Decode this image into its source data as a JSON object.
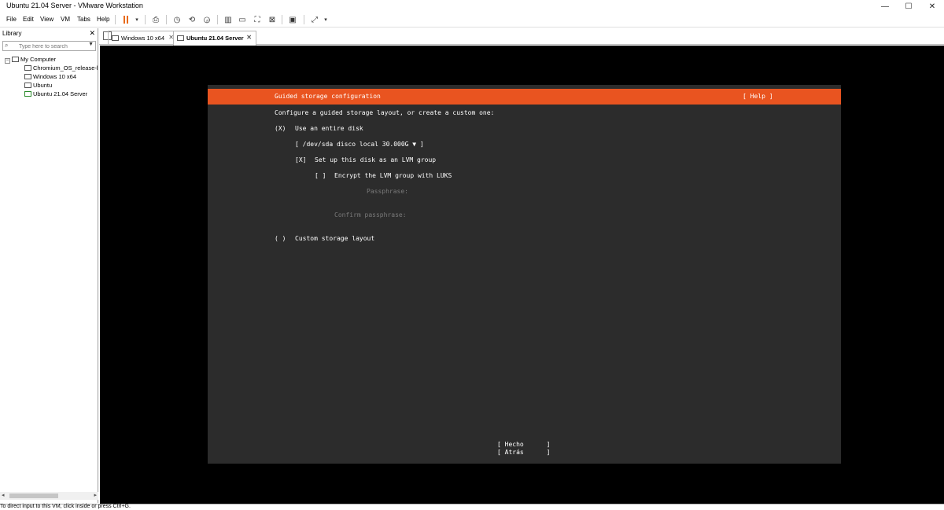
{
  "window": {
    "title": "Ubuntu 21.04 Server - VMware Workstation",
    "minimize": "—",
    "maximize": "☐",
    "close": "✕"
  },
  "menu": [
    "File",
    "Edit",
    "View",
    "VM",
    "Tabs",
    "Help"
  ],
  "toolbar_icons": [
    "pause-icon",
    "dropdown-icon",
    "send-keys-icon",
    "snapshot-icon",
    "revert-snapshot-icon",
    "snapshot-manager-icon",
    "library-view-icon",
    "thumbnail-view-icon",
    "fullscreen-icon",
    "unity-icon",
    "console-icon",
    "stretch-icon"
  ],
  "library": {
    "title": "Library",
    "close": "✕",
    "search_placeholder": "Type here to search",
    "root": "My Computer",
    "items": [
      "Chromium_OS_release-l",
      "Windows 10 x64",
      "Ubuntu",
      "Ubuntu 21.04 Server"
    ]
  },
  "tabs": [
    {
      "label": "Windows 10 x64",
      "active": false
    },
    {
      "label": "Ubuntu 21.04 Server",
      "active": true
    }
  ],
  "installer": {
    "header_title": "Guided storage configuration",
    "help": "[ Help ]",
    "intro": "Configure a guided storage layout, or create a custom one:",
    "use_entire_disk_radio": "(X)",
    "use_entire_disk_label": "Use an entire disk",
    "disk_select": "[ /dev/sda disco local 30.000G ▼ ]",
    "lvm_checkbox": "[X]",
    "lvm_label": "Set up this disk as an LVM group",
    "encrypt_checkbox": "[ ]",
    "encrypt_label": "Encrypt the LVM group with LUKS",
    "passphrase_label": "Passphrase:",
    "confirm_passphrase_label": "Confirm passphrase:",
    "custom_radio": "( )",
    "custom_label": "Custom storage layout",
    "done_button": "[ Hecho      ]",
    "back_button": "[ Atrás      ]"
  },
  "colors": {
    "header": "#e95420",
    "installer_bg": "#2c2c2c",
    "console_bg": "#000000"
  },
  "status_text": "To direct input to this VM, click inside or press Ctrl+G."
}
